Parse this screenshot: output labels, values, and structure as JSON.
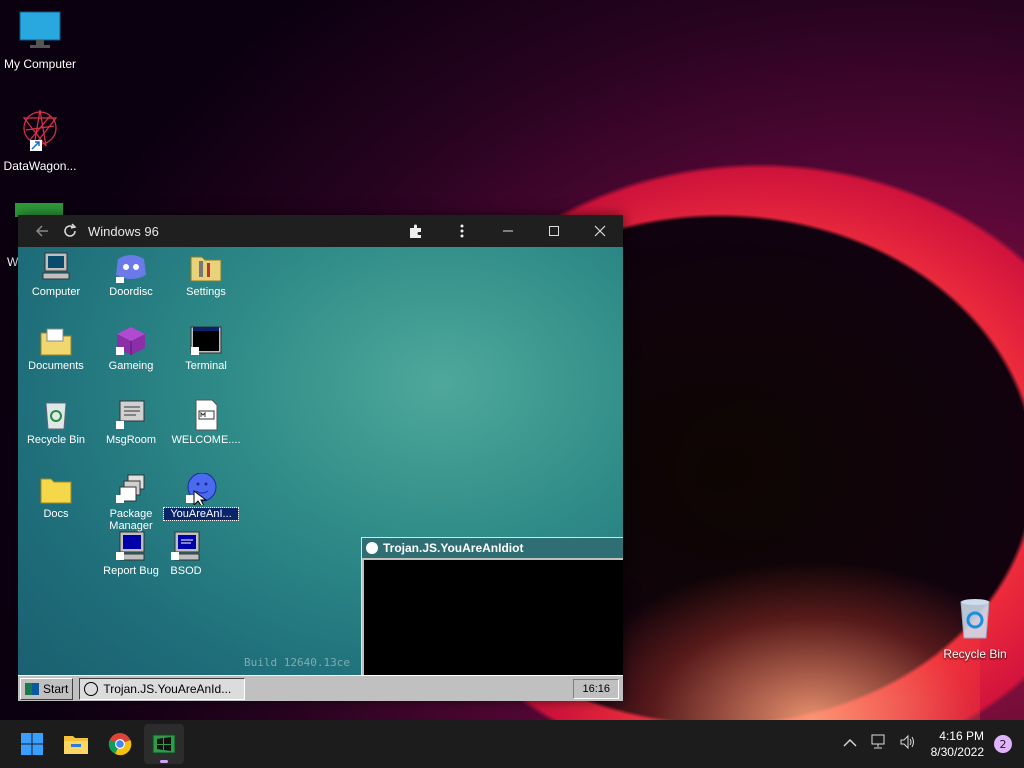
{
  "desktop": {
    "icons": [
      {
        "label": "My Computer",
        "icon": "monitor-icon"
      },
      {
        "label": "DataWagon...",
        "icon": "datawagon-icon"
      },
      {
        "label": "Recycle Bin",
        "icon": "recycle-bin-icon"
      }
    ],
    "partial_icon_label": "W"
  },
  "app_window": {
    "title": "Windows 96",
    "buttons": {
      "back": "back-arrow-icon",
      "reload": "reload-icon",
      "extensions": "puzzle-icon",
      "menu": "kebab-menu-icon",
      "minimize": "minimize-icon",
      "maximize": "maximize-icon",
      "close": "close-icon"
    }
  },
  "w96": {
    "icons": [
      {
        "label": "Computer"
      },
      {
        "label": "Doordisc"
      },
      {
        "label": "Settings"
      },
      {
        "label": "Documents"
      },
      {
        "label": "Gameing"
      },
      {
        "label": "Terminal"
      },
      {
        "label": "Recycle Bin"
      },
      {
        "label": "MsgRoom"
      },
      {
        "label": "WELCOME...."
      },
      {
        "label": "Docs"
      },
      {
        "label": "Package Manager"
      },
      {
        "label": "YouAreAnI..."
      },
      {
        "label": "Report Bug"
      },
      {
        "label": "BSOD"
      }
    ],
    "build": "Build 12640.13ce",
    "popup_title": "Trojan.JS.YouAreAnIdiot",
    "taskbar": {
      "start": "Start",
      "task": "Trojan.JS.YouAreAnId...",
      "clock": "16:16"
    }
  },
  "taskbar": {
    "apps": [
      "windows-start-icon",
      "file-explorer-icon",
      "chrome-icon",
      "windows96-icon"
    ],
    "time": "4:16 PM",
    "date": "8/30/2022",
    "notifications": "2"
  },
  "colors": {
    "w96_teal": "#2f8c88",
    "taskbar": "#1c1c1c",
    "select": "#0a246a"
  }
}
